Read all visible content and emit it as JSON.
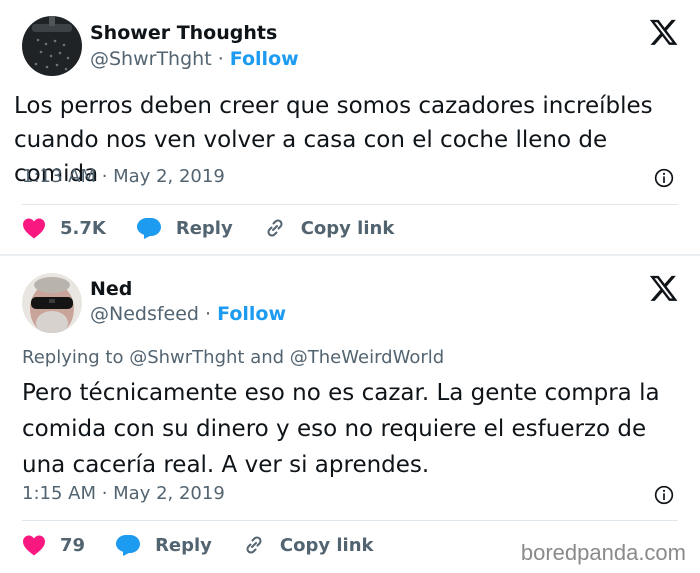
{
  "tweets": [
    {
      "name": "Shower Thoughts",
      "handle": "@ShwrThght",
      "separator": " · ",
      "follow": "Follow",
      "text": "Los perros deben creer que somos cazadores increíbles cuando nos ven volver a casa con el coche lleno de comida",
      "time": "1:13 AM · May 2, 2019",
      "likes": "5.7K",
      "reply": "Reply",
      "copy_link": "Copy link"
    },
    {
      "name": "Ned",
      "handle": "@Nedsfeed",
      "separator": " · ",
      "follow": "Follow",
      "replying_prefix": "Replying to ",
      "replying_mention_1": "@ShwrThght",
      "replying_and": " and ",
      "replying_mention_2": "@TheWeirdWorld",
      "text": "Pero técnicamente eso no es cazar. La gente compra la comida con su dinero y eso no requiere el esfuerzo de una cacería real. A ver si aprendes.",
      "time": "1:15 AM · May 2, 2019",
      "likes": "79",
      "reply": "Reply",
      "copy_link": "Copy link"
    }
  ],
  "watermark": "boredpanda.com",
  "colors": {
    "heart": "#f91880",
    "reply_bubble": "#1d9bf0",
    "follow": "#1d9bf0",
    "muted": "#536471"
  }
}
